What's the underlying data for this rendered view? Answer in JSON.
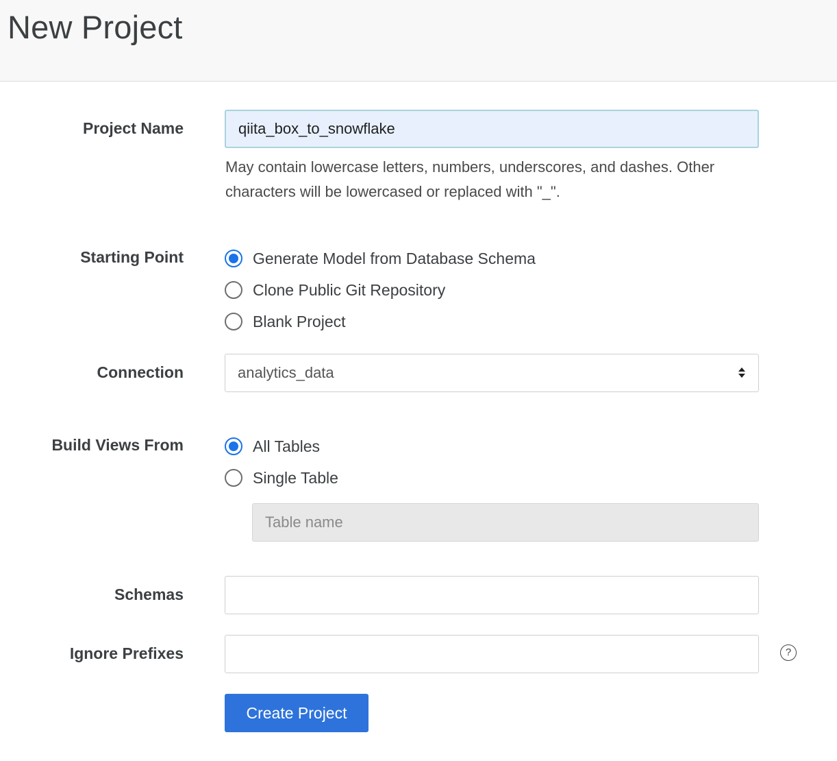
{
  "page": {
    "title": "New Project"
  },
  "form": {
    "project_name": {
      "label": "Project Name",
      "value": "qiita_box_to_snowflake",
      "help": "May contain lowercase letters, numbers, underscores, and dashes. Other characters will be lowercased or replaced with \"_\"."
    },
    "starting_point": {
      "label": "Starting Point",
      "options": [
        {
          "label": "Generate Model from Database Schema",
          "checked": true
        },
        {
          "label": "Clone Public Git Repository",
          "checked": false
        },
        {
          "label": "Blank Project",
          "checked": false
        }
      ]
    },
    "connection": {
      "label": "Connection",
      "selected": "analytics_data"
    },
    "build_views_from": {
      "label": "Build Views From",
      "options": [
        {
          "label": "All Tables",
          "checked": true
        },
        {
          "label": "Single Table",
          "checked": false
        }
      ],
      "table_name_placeholder": "Table name"
    },
    "schemas": {
      "label": "Schemas",
      "value": ""
    },
    "ignore_prefixes": {
      "label": "Ignore Prefixes",
      "value": "",
      "help_icon": "?"
    },
    "submit_label": "Create Project"
  },
  "colors": {
    "accent": "#1a73e8",
    "button": "#2e73db",
    "header_bg": "#f8f8f8",
    "focused_input_bg": "#e8f0fe"
  },
  "icons": {
    "help": "question-circle-icon",
    "select": "up-down-arrows-icon"
  }
}
